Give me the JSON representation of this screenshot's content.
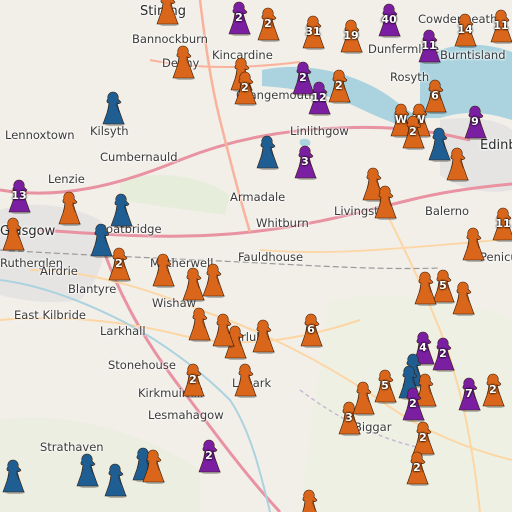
{
  "colors": {
    "witch_orange": "#d9661a",
    "witch_purple": "#7a1fa2",
    "witch_blue": "#1f5e93",
    "water": "#aad3df",
    "land": "#f2efe9",
    "motorway": "#e892a2",
    "trunk": "#f9b29c"
  },
  "icons": {
    "marker": "witch-figure-icon",
    "cluster_glyph": "W"
  },
  "places": [
    {
      "name": "Stirling"
    },
    {
      "name": "Bannockburn"
    },
    {
      "name": "Cowdenbeath"
    },
    {
      "name": "Burntisland"
    },
    {
      "name": "Kincardine"
    },
    {
      "name": "Denny"
    },
    {
      "name": "Linlithgow"
    },
    {
      "name": "Lennoxtown"
    },
    {
      "name": "Kilsyth"
    },
    {
      "name": "Cumbernauld"
    },
    {
      "name": "Lenzie"
    },
    {
      "name": "Glasgow"
    },
    {
      "name": "Armadale"
    },
    {
      "name": "Livingston"
    },
    {
      "name": "Balerno"
    },
    {
      "name": "Whitburn"
    },
    {
      "name": "Fauldhouse"
    },
    {
      "name": "Rutherglen"
    },
    {
      "name": "Coatbridge"
    },
    {
      "name": "Blantyre"
    },
    {
      "name": "Motherwell"
    },
    {
      "name": "East Kilbride"
    },
    {
      "name": "Wishaw"
    },
    {
      "name": "Larkhall"
    },
    {
      "name": "Stonehouse"
    },
    {
      "name": "Kirkmuirhill"
    },
    {
      "name": "Lesmahagow"
    },
    {
      "name": "Lanark"
    },
    {
      "name": "Carluke"
    },
    {
      "name": "Biggar"
    },
    {
      "name": "Penicuik"
    },
    {
      "name": "Edinburgh"
    },
    {
      "name": "Grangemouth"
    },
    {
      "name": "Rosyth"
    },
    {
      "name": "Dunfermline"
    },
    {
      "name": "Strathaven"
    },
    {
      "name": "Airdrie"
    }
  ],
  "markers": [
    {
      "color": "orange",
      "count": ""
    },
    {
      "color": "purple",
      "count": "2"
    },
    {
      "color": "orange",
      "count": "2"
    },
    {
      "color": "purple",
      "count": "40"
    },
    {
      "color": "orange",
      "count": "11"
    },
    {
      "color": "orange",
      "count": "31"
    },
    {
      "color": "orange",
      "count": "19"
    },
    {
      "color": "orange",
      "count": "14"
    },
    {
      "color": "purple",
      "count": "11"
    },
    {
      "color": "orange",
      "count": ""
    },
    {
      "color": "orange",
      "count": ""
    },
    {
      "color": "orange",
      "count": "2"
    },
    {
      "color": "purple",
      "count": "2"
    },
    {
      "color": "purple",
      "count": "12"
    },
    {
      "color": "orange",
      "count": "2"
    },
    {
      "color": "blue",
      "count": ""
    },
    {
      "color": "orange",
      "count": "6"
    },
    {
      "color": "orange",
      "count": "W"
    },
    {
      "color": "orange",
      "count": "W"
    },
    {
      "color": "purple",
      "count": "9"
    },
    {
      "color": "orange",
      "count": "2"
    },
    {
      "color": "blue",
      "count": ""
    },
    {
      "color": "purple",
      "count": "3"
    },
    {
      "color": "orange",
      "count": ""
    },
    {
      "color": "orange",
      "count": ""
    },
    {
      "color": "blue",
      "count": ""
    },
    {
      "color": "orange",
      "count": ""
    },
    {
      "color": "purple",
      "count": "13"
    },
    {
      "color": "orange",
      "count": ""
    },
    {
      "color": "blue",
      "count": ""
    },
    {
      "color": "orange",
      "count": ""
    },
    {
      "color": "blue",
      "count": ""
    },
    {
      "color": "orange",
      "count": "2"
    },
    {
      "color": "orange",
      "count": ""
    },
    {
      "color": "orange",
      "count": ""
    },
    {
      "color": "orange",
      "count": ""
    },
    {
      "color": "orange",
      "count": "6"
    },
    {
      "color": "orange",
      "count": ""
    },
    {
      "color": "orange",
      "count": ""
    },
    {
      "color": "orange",
      "count": ""
    },
    {
      "color": "orange",
      "count": ""
    },
    {
      "color": "orange",
      "count": "11"
    },
    {
      "color": "orange",
      "count": "2"
    },
    {
      "color": "orange",
      "count": "5"
    },
    {
      "color": "orange",
      "count": ""
    },
    {
      "color": "purple",
      "count": "4"
    },
    {
      "color": "purple",
      "count": "2"
    },
    {
      "color": "blue",
      "count": ""
    },
    {
      "color": "orange",
      "count": ""
    },
    {
      "color": "blue",
      "count": ""
    },
    {
      "color": "orange",
      "count": ""
    },
    {
      "color": "orange",
      "count": "5"
    },
    {
      "color": "orange",
      "count": "3"
    },
    {
      "color": "purple",
      "count": "2"
    },
    {
      "color": "orange",
      "count": ""
    },
    {
      "color": "purple",
      "count": "7"
    },
    {
      "color": "orange",
      "count": "2"
    },
    {
      "color": "orange",
      "count": "2"
    },
    {
      "color": "orange",
      "count": "2"
    },
    {
      "color": "purple",
      "count": "2"
    },
    {
      "color": "blue",
      "count": ""
    },
    {
      "color": "blue",
      "count": ""
    },
    {
      "color": "blue",
      "count": ""
    },
    {
      "color": "blue",
      "count": ""
    },
    {
      "color": "orange",
      "count": ""
    },
    {
      "color": "orange",
      "count": ""
    },
    {
      "color": "orange",
      "count": ""
    },
    {
      "color": "orange",
      "count": ""
    }
  ]
}
